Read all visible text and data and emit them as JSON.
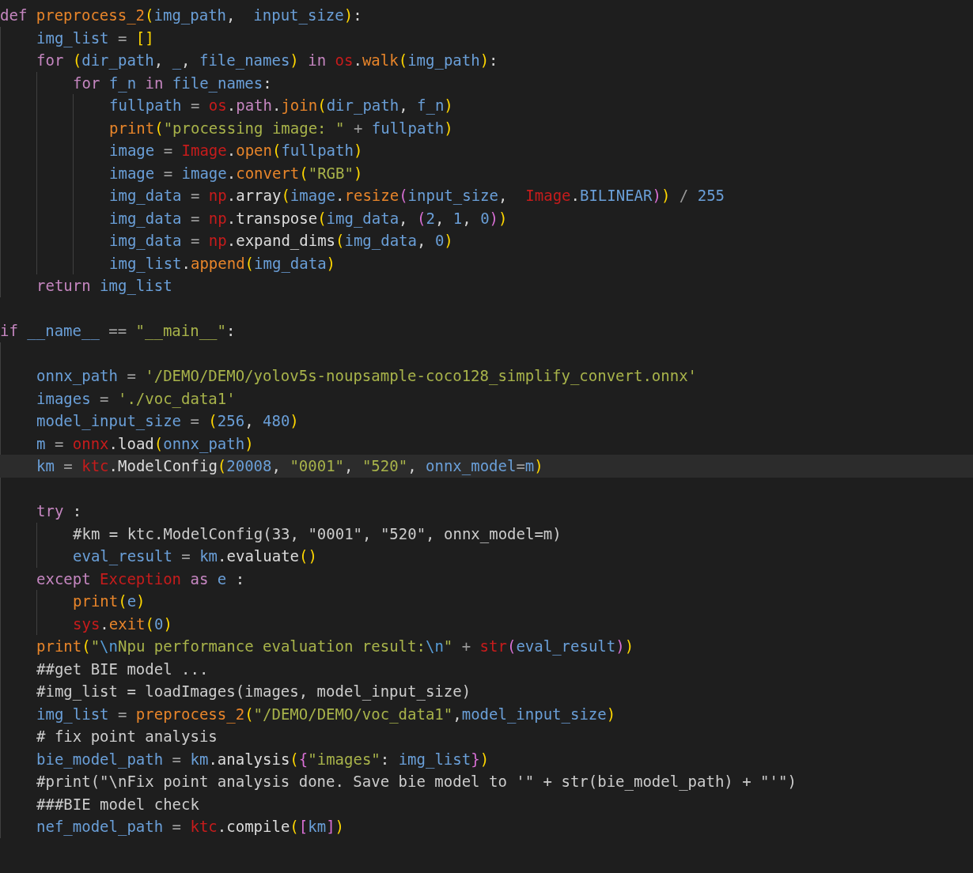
{
  "editor": {
    "lines": [
      {
        "kind": "code",
        "current": false,
        "tokens": [
          {
            "kind": "keyword",
            "text": "def "
          },
          {
            "kind": "function",
            "text": "preprocess_2"
          },
          {
            "kind": "bracket1",
            "text": "("
          },
          {
            "kind": "variable",
            "text": "img_path"
          },
          {
            "kind": "punctuation",
            "text": ",  "
          },
          {
            "kind": "variable",
            "text": "input_size"
          },
          {
            "kind": "bracket1",
            "text": ")"
          },
          {
            "kind": "punctuation",
            "text": ":"
          }
        ],
        "children": [
          {
            "kind": "code",
            "current": false,
            "tokens": [
              {
                "kind": "variable",
                "text": "img_list"
              },
              {
                "kind": "operator",
                "text": " = "
              },
              {
                "kind": "bracket1",
                "text": "[]"
              }
            ]
          },
          {
            "kind": "code",
            "current": false,
            "tokens": [
              {
                "kind": "keyword",
                "text": "for "
              },
              {
                "kind": "bracket1",
                "text": "("
              },
              {
                "kind": "variable",
                "text": "dir_path"
              },
              {
                "kind": "punctuation",
                "text": ", "
              },
              {
                "kind": "variable",
                "text": "_"
              },
              {
                "kind": "punctuation",
                "text": ", "
              },
              {
                "kind": "variable",
                "text": "file_names"
              },
              {
                "kind": "bracket1",
                "text": ")"
              },
              {
                "kind": "keyword",
                "text": " in "
              },
              {
                "kind": "module",
                "text": "os"
              },
              {
                "kind": "punctuation",
                "text": "."
              },
              {
                "kind": "function",
                "text": "walk"
              },
              {
                "kind": "bracket1",
                "text": "("
              },
              {
                "kind": "variable",
                "text": "img_path"
              },
              {
                "kind": "bracket1",
                "text": ")"
              },
              {
                "kind": "punctuation",
                "text": ":"
              }
            ],
            "children": [
              {
                "kind": "code",
                "current": false,
                "tokens": [
                  {
                    "kind": "keyword",
                    "text": "for "
                  },
                  {
                    "kind": "variable",
                    "text": "f_n"
                  },
                  {
                    "kind": "keyword",
                    "text": " in "
                  },
                  {
                    "kind": "variable",
                    "text": "file_names"
                  },
                  {
                    "kind": "punctuation",
                    "text": ":"
                  }
                ],
                "children": [
                  {
                    "kind": "code",
                    "current": false,
                    "tokens": [
                      {
                        "kind": "variable",
                        "text": "fullpath"
                      },
                      {
                        "kind": "operator",
                        "text": " = "
                      },
                      {
                        "kind": "module",
                        "text": "os"
                      },
                      {
                        "kind": "punctuation",
                        "text": "."
                      },
                      {
                        "kind": "property",
                        "text": "path"
                      },
                      {
                        "kind": "punctuation",
                        "text": "."
                      },
                      {
                        "kind": "function",
                        "text": "join"
                      },
                      {
                        "kind": "bracket1",
                        "text": "("
                      },
                      {
                        "kind": "variable",
                        "text": "dir_path"
                      },
                      {
                        "kind": "punctuation",
                        "text": ", "
                      },
                      {
                        "kind": "variable",
                        "text": "f_n"
                      },
                      {
                        "kind": "bracket1",
                        "text": ")"
                      }
                    ]
                  },
                  {
                    "kind": "code",
                    "current": false,
                    "tokens": [
                      {
                        "kind": "function",
                        "text": "print"
                      },
                      {
                        "kind": "bracket1",
                        "text": "("
                      },
                      {
                        "kind": "string",
                        "text": "\"processing image: \""
                      },
                      {
                        "kind": "operator",
                        "text": " + "
                      },
                      {
                        "kind": "variable",
                        "text": "fullpath"
                      },
                      {
                        "kind": "bracket1",
                        "text": ")"
                      }
                    ]
                  },
                  {
                    "kind": "code",
                    "current": false,
                    "tokens": [
                      {
                        "kind": "variable",
                        "text": "image"
                      },
                      {
                        "kind": "operator",
                        "text": " = "
                      },
                      {
                        "kind": "module",
                        "text": "Image"
                      },
                      {
                        "kind": "punctuation",
                        "text": "."
                      },
                      {
                        "kind": "function",
                        "text": "open"
                      },
                      {
                        "kind": "bracket1",
                        "text": "("
                      },
                      {
                        "kind": "variable",
                        "text": "fullpath"
                      },
                      {
                        "kind": "bracket1",
                        "text": ")"
                      }
                    ]
                  },
                  {
                    "kind": "code",
                    "current": false,
                    "tokens": [
                      {
                        "kind": "variable",
                        "text": "image"
                      },
                      {
                        "kind": "operator",
                        "text": " = "
                      },
                      {
                        "kind": "variable",
                        "text": "image"
                      },
                      {
                        "kind": "punctuation",
                        "text": "."
                      },
                      {
                        "kind": "function",
                        "text": "convert"
                      },
                      {
                        "kind": "bracket1",
                        "text": "("
                      },
                      {
                        "kind": "string",
                        "text": "\"RGB\""
                      },
                      {
                        "kind": "bracket1",
                        "text": ")"
                      }
                    ]
                  },
                  {
                    "kind": "code",
                    "current": false,
                    "tokens": [
                      {
                        "kind": "variable",
                        "text": "img_data"
                      },
                      {
                        "kind": "operator",
                        "text": " = "
                      },
                      {
                        "kind": "module",
                        "text": "np"
                      },
                      {
                        "kind": "punctuation",
                        "text": "."
                      },
                      {
                        "kind": "method",
                        "text": "array"
                      },
                      {
                        "kind": "bracket1",
                        "text": "("
                      },
                      {
                        "kind": "variable",
                        "text": "image"
                      },
                      {
                        "kind": "punctuation",
                        "text": "."
                      },
                      {
                        "kind": "function",
                        "text": "resize"
                      },
                      {
                        "kind": "bracket2",
                        "text": "("
                      },
                      {
                        "kind": "variable",
                        "text": "input_size"
                      },
                      {
                        "kind": "punctuation",
                        "text": ",  "
                      },
                      {
                        "kind": "module",
                        "text": "Image"
                      },
                      {
                        "kind": "punctuation",
                        "text": "."
                      },
                      {
                        "kind": "variable",
                        "text": "BILINEAR"
                      },
                      {
                        "kind": "bracket2",
                        "text": ")"
                      },
                      {
                        "kind": "bracket1",
                        "text": ")"
                      },
                      {
                        "kind": "operator",
                        "text": " / "
                      },
                      {
                        "kind": "number",
                        "text": "255"
                      }
                    ]
                  },
                  {
                    "kind": "code",
                    "current": false,
                    "tokens": [
                      {
                        "kind": "variable",
                        "text": "img_data"
                      },
                      {
                        "kind": "operator",
                        "text": " = "
                      },
                      {
                        "kind": "module",
                        "text": "np"
                      },
                      {
                        "kind": "punctuation",
                        "text": "."
                      },
                      {
                        "kind": "method",
                        "text": "transpose"
                      },
                      {
                        "kind": "bracket1",
                        "text": "("
                      },
                      {
                        "kind": "variable",
                        "text": "img_data"
                      },
                      {
                        "kind": "punctuation",
                        "text": ", "
                      },
                      {
                        "kind": "bracket2",
                        "text": "("
                      },
                      {
                        "kind": "number",
                        "text": "2"
                      },
                      {
                        "kind": "punctuation",
                        "text": ", "
                      },
                      {
                        "kind": "number",
                        "text": "1"
                      },
                      {
                        "kind": "punctuation",
                        "text": ", "
                      },
                      {
                        "kind": "number",
                        "text": "0"
                      },
                      {
                        "kind": "bracket2",
                        "text": ")"
                      },
                      {
                        "kind": "bracket1",
                        "text": ")"
                      }
                    ]
                  },
                  {
                    "kind": "code",
                    "current": false,
                    "tokens": [
                      {
                        "kind": "variable",
                        "text": "img_data"
                      },
                      {
                        "kind": "operator",
                        "text": " = "
                      },
                      {
                        "kind": "module",
                        "text": "np"
                      },
                      {
                        "kind": "punctuation",
                        "text": "."
                      },
                      {
                        "kind": "method",
                        "text": "expand_dims"
                      },
                      {
                        "kind": "bracket1",
                        "text": "("
                      },
                      {
                        "kind": "variable",
                        "text": "img_data"
                      },
                      {
                        "kind": "punctuation",
                        "text": ", "
                      },
                      {
                        "kind": "number",
                        "text": "0"
                      },
                      {
                        "kind": "bracket1",
                        "text": ")"
                      }
                    ]
                  },
                  {
                    "kind": "code",
                    "current": false,
                    "tokens": [
                      {
                        "kind": "variable",
                        "text": "img_list"
                      },
                      {
                        "kind": "punctuation",
                        "text": "."
                      },
                      {
                        "kind": "function",
                        "text": "append"
                      },
                      {
                        "kind": "bracket1",
                        "text": "("
                      },
                      {
                        "kind": "variable",
                        "text": "img_data"
                      },
                      {
                        "kind": "bracket1",
                        "text": ")"
                      }
                    ]
                  }
                ]
              }
            ]
          },
          {
            "kind": "code",
            "current": false,
            "tokens": [
              {
                "kind": "keyword",
                "text": "return "
              },
              {
                "kind": "variable",
                "text": "img_list"
              }
            ]
          }
        ]
      },
      {
        "kind": "blank",
        "current": false
      },
      {
        "kind": "code",
        "current": false,
        "tokens": [
          {
            "kind": "keyword",
            "text": "if "
          },
          {
            "kind": "variable",
            "text": "__name__"
          },
          {
            "kind": "operator",
            "text": " == "
          },
          {
            "kind": "string",
            "text": "\"__main__\""
          },
          {
            "kind": "punctuation",
            "text": ":"
          }
        ],
        "children": [
          {
            "kind": "blank",
            "current": false
          },
          {
            "kind": "code",
            "current": false,
            "tokens": [
              {
                "kind": "variable",
                "text": "onnx_path"
              },
              {
                "kind": "operator",
                "text": " = "
              },
              {
                "kind": "string",
                "text": "'/DEMO/DEMO/yolov5s-noupsample-coco128_simplify_convert.onnx'"
              }
            ]
          },
          {
            "kind": "code",
            "current": false,
            "tokens": [
              {
                "kind": "variable",
                "text": "images"
              },
              {
                "kind": "operator",
                "text": " = "
              },
              {
                "kind": "string",
                "text": "'./voc_data1'"
              }
            ]
          },
          {
            "kind": "code",
            "current": false,
            "tokens": [
              {
                "kind": "variable",
                "text": "model_input_size"
              },
              {
                "kind": "operator",
                "text": " = "
              },
              {
                "kind": "bracket1",
                "text": "("
              },
              {
                "kind": "number",
                "text": "256"
              },
              {
                "kind": "punctuation",
                "text": ", "
              },
              {
                "kind": "number",
                "text": "480"
              },
              {
                "kind": "bracket1",
                "text": ")"
              }
            ]
          },
          {
            "kind": "code",
            "current": false,
            "tokens": [
              {
                "kind": "variable",
                "text": "m"
              },
              {
                "kind": "operator",
                "text": " = "
              },
              {
                "kind": "module",
                "text": "onnx"
              },
              {
                "kind": "punctuation",
                "text": "."
              },
              {
                "kind": "method",
                "text": "load"
              },
              {
                "kind": "bracket1",
                "text": "("
              },
              {
                "kind": "variable",
                "text": "onnx_path"
              },
              {
                "kind": "bracket1",
                "text": ")"
              }
            ]
          },
          {
            "kind": "code",
            "current": true,
            "tokens": [
              {
                "kind": "variable",
                "text": "km"
              },
              {
                "kind": "operator",
                "text": " = "
              },
              {
                "kind": "module",
                "text": "ktc"
              },
              {
                "kind": "punctuation",
                "text": "."
              },
              {
                "kind": "method",
                "text": "ModelConfig"
              },
              {
                "kind": "bracket1",
                "text": "("
              },
              {
                "kind": "number",
                "text": "20008"
              },
              {
                "kind": "punctuation",
                "text": ", "
              },
              {
                "kind": "string",
                "text": "\"0001\""
              },
              {
                "kind": "punctuation",
                "text": ", "
              },
              {
                "kind": "string",
                "text": "\"520\""
              },
              {
                "kind": "punctuation",
                "text": ", "
              },
              {
                "kind": "variable",
                "text": "onnx_model"
              },
              {
                "kind": "operator",
                "text": "="
              },
              {
                "kind": "variable",
                "text": "m"
              },
              {
                "kind": "bracket1",
                "text": ")"
              }
            ]
          },
          {
            "kind": "blank",
            "current": false
          },
          {
            "kind": "code",
            "current": false,
            "tokens": [
              {
                "kind": "keyword",
                "text": "try"
              },
              {
                "kind": "punctuation",
                "text": " :"
              }
            ],
            "children": [
              {
                "kind": "code",
                "current": false,
                "tokens": [
                  {
                    "kind": "comment",
                    "text": "#km = ktc.ModelConfig(33, \"0001\", \"520\", onnx_model=m)"
                  }
                ]
              },
              {
                "kind": "code",
                "current": false,
                "tokens": [
                  {
                    "kind": "variable",
                    "text": "eval_result"
                  },
                  {
                    "kind": "operator",
                    "text": " = "
                  },
                  {
                    "kind": "variable",
                    "text": "km"
                  },
                  {
                    "kind": "punctuation",
                    "text": "."
                  },
                  {
                    "kind": "method",
                    "text": "evaluate"
                  },
                  {
                    "kind": "bracket1",
                    "text": "()"
                  }
                ]
              }
            ]
          },
          {
            "kind": "code",
            "current": false,
            "tokens": [
              {
                "kind": "keyword",
                "text": "except "
              },
              {
                "kind": "module",
                "text": "Exception"
              },
              {
                "kind": "keyword",
                "text": " as "
              },
              {
                "kind": "variable",
                "text": "e"
              },
              {
                "kind": "punctuation",
                "text": " :"
              }
            ],
            "children": [
              {
                "kind": "code",
                "current": false,
                "tokens": [
                  {
                    "kind": "function",
                    "text": "print"
                  },
                  {
                    "kind": "bracket1",
                    "text": "("
                  },
                  {
                    "kind": "variable",
                    "text": "e"
                  },
                  {
                    "kind": "bracket1",
                    "text": ")"
                  }
                ]
              },
              {
                "kind": "code",
                "current": false,
                "tokens": [
                  {
                    "kind": "module",
                    "text": "sys"
                  },
                  {
                    "kind": "punctuation",
                    "text": "."
                  },
                  {
                    "kind": "function",
                    "text": "exit"
                  },
                  {
                    "kind": "bracket1",
                    "text": "("
                  },
                  {
                    "kind": "number",
                    "text": "0"
                  },
                  {
                    "kind": "bracket1",
                    "text": ")"
                  }
                ]
              }
            ]
          },
          {
            "kind": "code",
            "current": false,
            "tokens": [
              {
                "kind": "function",
                "text": "print"
              },
              {
                "kind": "bracket1",
                "text": "("
              },
              {
                "kind": "string",
                "text": "\""
              },
              {
                "kind": "escape",
                "text": "\\n"
              },
              {
                "kind": "string",
                "text": "Npu performance evaluation result:"
              },
              {
                "kind": "escape",
                "text": "\\n"
              },
              {
                "kind": "string",
                "text": "\""
              },
              {
                "kind": "operator",
                "text": " + "
              },
              {
                "kind": "module",
                "text": "str"
              },
              {
                "kind": "bracket2",
                "text": "("
              },
              {
                "kind": "variable",
                "text": "eval_result"
              },
              {
                "kind": "bracket2",
                "text": ")"
              },
              {
                "kind": "bracket1",
                "text": ")"
              }
            ]
          },
          {
            "kind": "code",
            "current": false,
            "tokens": [
              {
                "kind": "comment",
                "text": "##get BIE model ..."
              }
            ]
          },
          {
            "kind": "code",
            "current": false,
            "tokens": [
              {
                "kind": "comment",
                "text": "#img_list = loadImages(images, model_input_size)"
              }
            ]
          },
          {
            "kind": "code",
            "current": false,
            "tokens": [
              {
                "kind": "variable",
                "text": "img_list"
              },
              {
                "kind": "operator",
                "text": " = "
              },
              {
                "kind": "function",
                "text": "preprocess_2"
              },
              {
                "kind": "bracket1",
                "text": "("
              },
              {
                "kind": "string",
                "text": "\"/DEMO/DEMO/voc_data1\""
              },
              {
                "kind": "punctuation",
                "text": ","
              },
              {
                "kind": "variable",
                "text": "model_input_size"
              },
              {
                "kind": "bracket1",
                "text": ")"
              }
            ]
          },
          {
            "kind": "code",
            "current": false,
            "tokens": [
              {
                "kind": "comment",
                "text": "# fix point analysis"
              }
            ]
          },
          {
            "kind": "code",
            "current": false,
            "tokens": [
              {
                "kind": "variable",
                "text": "bie_model_path"
              },
              {
                "kind": "operator",
                "text": " = "
              },
              {
                "kind": "variable",
                "text": "km"
              },
              {
                "kind": "punctuation",
                "text": "."
              },
              {
                "kind": "method",
                "text": "analysis"
              },
              {
                "kind": "bracket1",
                "text": "("
              },
              {
                "kind": "bracket2",
                "text": "{"
              },
              {
                "kind": "string",
                "text": "\"images\""
              },
              {
                "kind": "punctuation",
                "text": ": "
              },
              {
                "kind": "variable",
                "text": "img_list"
              },
              {
                "kind": "bracket2",
                "text": "}"
              },
              {
                "kind": "bracket1",
                "text": ")"
              }
            ]
          },
          {
            "kind": "code",
            "current": false,
            "tokens": [
              {
                "kind": "comment",
                "text": "#print(\"\\nFix point analysis done. Save bie model to '\" + str(bie_model_path) + \"'\")"
              }
            ]
          },
          {
            "kind": "code",
            "current": false,
            "tokens": [
              {
                "kind": "comment",
                "text": "###BIE model check"
              }
            ]
          },
          {
            "kind": "code",
            "current": false,
            "tokens": [
              {
                "kind": "variable",
                "text": "nef_model_path"
              },
              {
                "kind": "operator",
                "text": " = "
              },
              {
                "kind": "module",
                "text": "ktc"
              },
              {
                "kind": "punctuation",
                "text": "."
              },
              {
                "kind": "method",
                "text": "compile"
              },
              {
                "kind": "bracket1",
                "text": "("
              },
              {
                "kind": "bracket2",
                "text": "["
              },
              {
                "kind": "variable",
                "text": "km"
              },
              {
                "kind": "bracket2",
                "text": "]"
              },
              {
                "kind": "bracket1",
                "text": ")"
              }
            ]
          }
        ]
      }
    ]
  }
}
